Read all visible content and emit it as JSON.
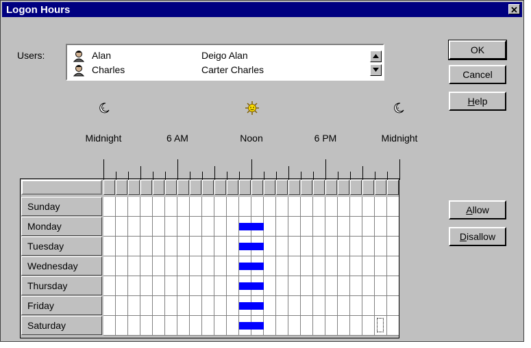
{
  "window": {
    "title": "Logon Hours",
    "close_glyph": "✕"
  },
  "users": {
    "label": "Users:",
    "items": [
      {
        "name": "Alan",
        "full_name": "Deigo Alan"
      },
      {
        "name": "Charles",
        "full_name": "Carter Charles"
      }
    ]
  },
  "buttons": {
    "ok": "OK",
    "cancel": "Cancel",
    "help_underlined": "H",
    "help_rest": "elp",
    "allow_underlined": "A",
    "allow_rest": "llow",
    "disallow_underlined": "D",
    "disallow_rest": "isallow"
  },
  "time_labels": [
    "Midnight",
    "6 AM",
    "Noon",
    "6 PM",
    "Midnight"
  ],
  "icons": {
    "left": "moon-icon",
    "center": "sun-icon",
    "right": "moon-icon",
    "user": "user-icon",
    "scroll_up": "scroll-up-icon",
    "scroll_down": "scroll-down-icon"
  },
  "days": [
    "Sunday",
    "Monday",
    "Tuesday",
    "Wednesday",
    "Thursday",
    "Friday",
    "Saturday"
  ],
  "colors": {
    "title_bar": "#000080",
    "allowed_hours": "#0000ff",
    "window_bg": "#c0c0c0"
  },
  "allowed_hours": {
    "Sunday": [],
    "Monday": [
      11,
      12
    ],
    "Tuesday": [
      11,
      12
    ],
    "Wednesday": [
      11,
      12
    ],
    "Thursday": [
      11,
      12
    ],
    "Friday": [
      11,
      12
    ],
    "Saturday": [
      11,
      12
    ]
  },
  "focused_cell": {
    "day": "Saturday",
    "hour": 22
  }
}
